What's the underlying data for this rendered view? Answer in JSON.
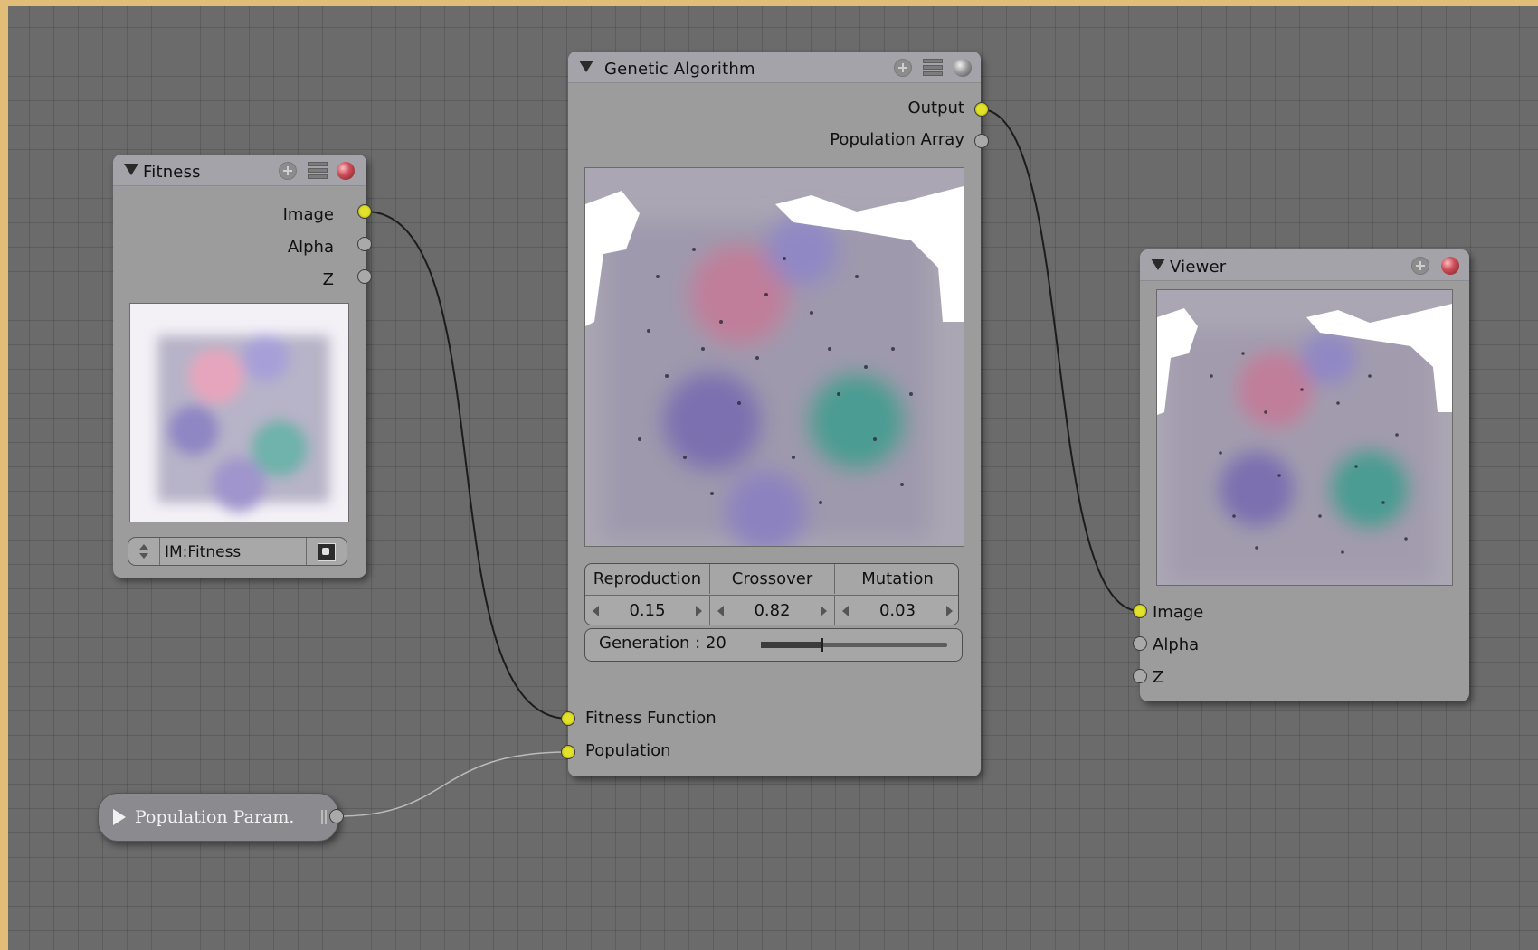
{
  "colors": {
    "frame": "#e2bd78",
    "grid_background": "#6b6b6b",
    "node_body": "#9c9c9c",
    "node_header": "#a3a3a9",
    "socket_connected": "#e2e22a",
    "socket_unconnected": "#a9a9a9",
    "wire": "#1c1c1c"
  },
  "nodes": {
    "fitness": {
      "title": "Fitness",
      "outputs": [
        "Image",
        "Alpha",
        "Z"
      ],
      "image_name": "IM:Fitness"
    },
    "genetic_algorithm": {
      "title": "Genetic Algorithm",
      "outputs": [
        "Output",
        "Population Array"
      ],
      "params": [
        {
          "name": "Reproduction",
          "value": "0.15"
        },
        {
          "name": "Crossover",
          "value": "0.82"
        },
        {
          "name": "Mutation",
          "value": "0.03"
        }
      ],
      "generation_label": "Generation : 20",
      "generation_slider_fraction": 0.33,
      "inputs": [
        "Fitness Function",
        "Population"
      ]
    },
    "viewer": {
      "title": "Viewer",
      "inputs": [
        "Image",
        "Alpha",
        "Z"
      ]
    },
    "population_param": {
      "title": "Population Param."
    }
  }
}
